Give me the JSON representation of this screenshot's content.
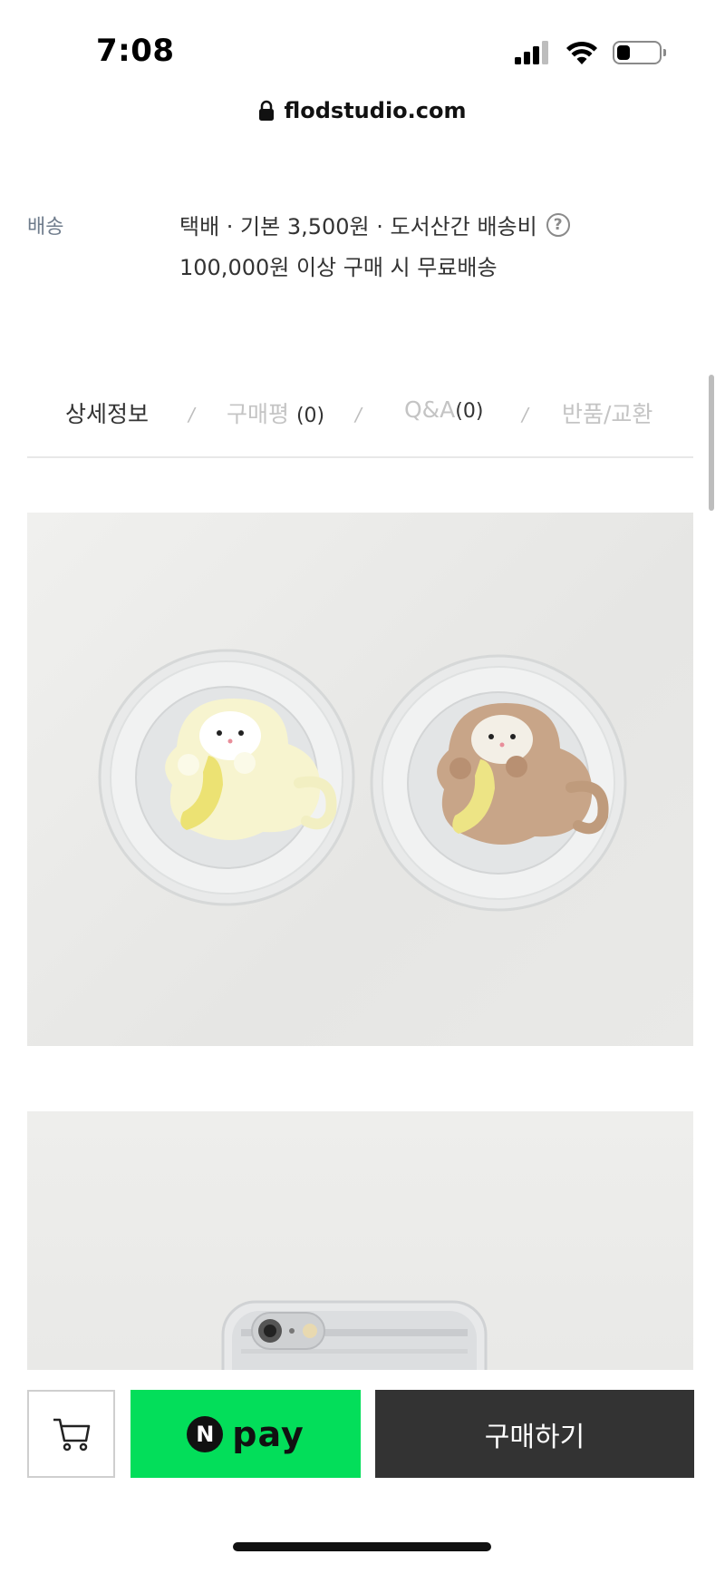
{
  "status_bar": {
    "time": "7:08"
  },
  "address_bar": {
    "url": "flodstudio.com"
  },
  "shipping": {
    "label": "배송",
    "line1": "택배 · 기본 3,500원 · 도서산간 배송비",
    "line2": "100,000원 이상 구매 시 무료배송",
    "help_glyph": "?"
  },
  "tabs": [
    {
      "label": "상세정보",
      "count": ""
    },
    {
      "label": "구매평",
      "count": "(0)"
    },
    {
      "label": "Q&A",
      "count": "(0)"
    },
    {
      "label": "반품/교환",
      "count": ""
    }
  ],
  "tab_separator": "/",
  "bottom_bar": {
    "npay_letter": "N",
    "npay_label": "pay",
    "buy_label": "구매하기"
  },
  "colors": {
    "npay_green": "#03de5a",
    "buy_dark": "#333333",
    "shipping_label": "#6f7c8c"
  },
  "icons": [
    "signal-icon",
    "wifi-icon",
    "battery-icon",
    "lock-icon",
    "help-icon",
    "cart-icon"
  ]
}
